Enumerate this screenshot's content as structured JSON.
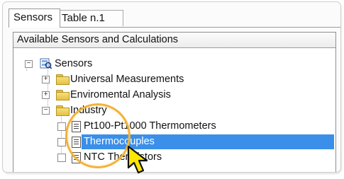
{
  "tabs": [
    {
      "label": "Sensors",
      "active": true
    },
    {
      "label": "Table n.1",
      "active": false
    }
  ],
  "group": {
    "title": "Available Sensors and Calculations"
  },
  "tree": {
    "root": {
      "label": "Sensors",
      "expanded": true
    },
    "folders": [
      {
        "label": "Universal Measurements",
        "expanded": false
      },
      {
        "label": "Enviromental Analysis",
        "expanded": false
      },
      {
        "label": "Industry",
        "expanded": true
      }
    ],
    "items": [
      {
        "label": "Pt100-Pt1000 Thermometers",
        "selected": false,
        "checked": false
      },
      {
        "label": "Thermocouples",
        "selected": true,
        "checked": false
      },
      {
        "label": "NTC Thermistors",
        "selected": false,
        "checked": false
      }
    ]
  },
  "colors": {
    "selection": "#3b8fe9",
    "highlight_ring": "#f2b33a",
    "cursor_fill": "#ffe600"
  },
  "icons": {
    "root": "sensors-icon",
    "folder": "folder-icon",
    "item": "document-icon",
    "pointer": "mouse-pointer-icon"
  }
}
